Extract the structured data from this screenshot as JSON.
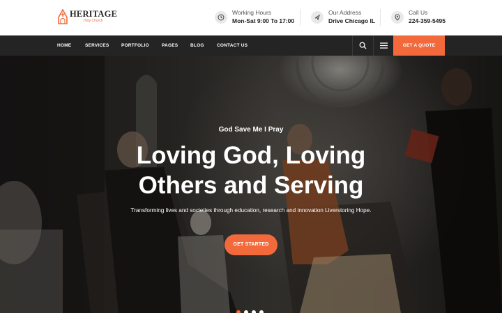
{
  "brand": {
    "name": "HERITAGE",
    "tagline": "Holy Church",
    "accent_color": "#f26a3c"
  },
  "contact": [
    {
      "icon": "clock-icon",
      "label": "Working Hours",
      "value": "Mon-Sat 9:00 To 17:00"
    },
    {
      "icon": "location-icon",
      "label": "Our Address",
      "value": "Drive Chicago IL"
    },
    {
      "icon": "phone-icon",
      "label": "Call Us",
      "value": "224-359-5495"
    }
  ],
  "nav": {
    "items": [
      "HOME",
      "SERVICES",
      "PORTFOLIO",
      "PAGES",
      "BLOG",
      "CONTACT US"
    ],
    "search_icon": "search-icon",
    "menu_icon": "menu-icon",
    "quote_label": "GET A QUOTE"
  },
  "hero": {
    "kicker": "God Save Me I Pray",
    "headline_line1": "Loving God, Loving",
    "headline_line2": "Others and Serving",
    "subtext": "Transforming lives and societies through education, research and innovation Liverstoring Hope.",
    "cta_label": "GET STARTED",
    "slides": 4,
    "active_slide": 1
  }
}
